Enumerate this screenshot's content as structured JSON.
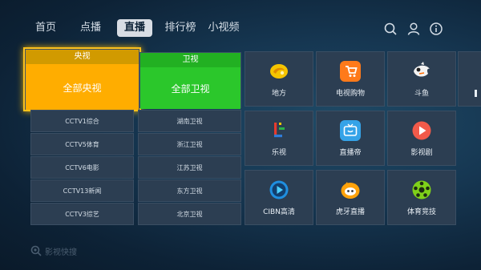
{
  "nav": {
    "tabs": [
      {
        "label": "首页"
      },
      {
        "label": "点播"
      },
      {
        "label": "直播"
      },
      {
        "label": "排行榜"
      },
      {
        "label": "小视频"
      }
    ],
    "active_tab": "直播",
    "icons": [
      "search-icon",
      "user-icon",
      "info-icon"
    ]
  },
  "categories": {
    "yangshi": {
      "header": "央视",
      "body": "全部央视"
    },
    "weishi": {
      "header": "卫视",
      "body": "全部卫视"
    }
  },
  "yangshi_channels": [
    "CCTV1综合",
    "CCTV5体育",
    "CCTV6电影",
    "CCTV13新闻",
    "CCTV3综艺"
  ],
  "weishi_channels": [
    "湖南卫视",
    "浙江卫视",
    "江苏卫视",
    "东方卫视",
    "北京卫视"
  ],
  "apps": [
    {
      "label": "地方",
      "icon": "yellow-swirl-icon"
    },
    {
      "label": "电视购物",
      "icon": "tv-shopping-icon"
    },
    {
      "label": "斗鱼",
      "icon": "douyu-fish-icon"
    },
    {
      "label": "乐视",
      "icon": "letv-icon"
    },
    {
      "label": "直播帝",
      "icon": "live-tv-icon"
    },
    {
      "label": "影视剧",
      "icon": "play-circle-icon"
    },
    {
      "label": "CIBN高清",
      "icon": "cibn-play-icon"
    },
    {
      "label": "虎牙直播",
      "icon": "huya-icon"
    },
    {
      "label": "体育竞技",
      "icon": "soccer-ball-icon"
    }
  ],
  "colors": {
    "focus": "#ffc21a",
    "yangshi_accent": "#ffad00",
    "weishi_accent": "#2bc72b"
  },
  "hint": {
    "text": "影视快搜"
  }
}
